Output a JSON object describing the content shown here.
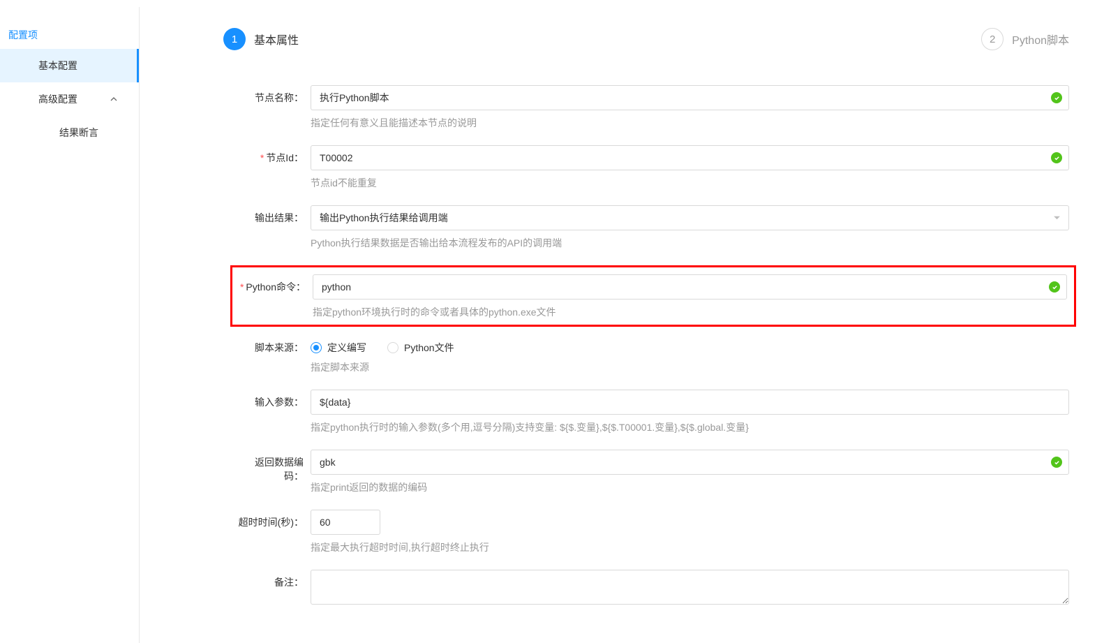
{
  "sidebar": {
    "title": "配置项",
    "items": [
      {
        "label": "基本配置",
        "active": true
      },
      {
        "label": "高级配置",
        "active": false,
        "expandable": true
      }
    ],
    "subitems": [
      {
        "label": "结果断言"
      }
    ]
  },
  "steps": {
    "step1": {
      "number": "1",
      "label": "基本属性"
    },
    "step2": {
      "number": "2",
      "label": "Python脚本"
    }
  },
  "form": {
    "node_name": {
      "label": "节点名称：",
      "value": "执行Python脚本",
      "hint": "指定任何有意义且能描述本节点的说明"
    },
    "node_id": {
      "label": "节点Id：",
      "value": "T00002",
      "hint": "节点id不能重复"
    },
    "output_result": {
      "label": "输出结果：",
      "value": "输出Python执行结果给调用端",
      "hint": "Python执行结果数据是否输出给本流程发布的API的调用端"
    },
    "python_cmd": {
      "label": "Python命令：",
      "value": "python",
      "hint": "指定python环境执行时的命令或者具体的python.exe文件"
    },
    "script_source": {
      "label": "脚本来源：",
      "options": [
        "定义编写",
        "Python文件"
      ],
      "selected": "定义编写",
      "hint": "指定脚本来源"
    },
    "input_params": {
      "label": "输入参数：",
      "value": "${data}",
      "hint": "指定python执行时的输入参数(多个用,逗号分隔)支持变量: ${$.变量},${$.T00001.变量},${$.global.变量}"
    },
    "return_encoding": {
      "label": "返回数据编码：",
      "value": "gbk",
      "hint": "指定print返回的数据的编码"
    },
    "timeout": {
      "label": "超时时间(秒)：",
      "value": "60",
      "hint": "指定最大执行超时时间,执行超时终止执行"
    },
    "remark": {
      "label": "备注：",
      "value": ""
    }
  }
}
